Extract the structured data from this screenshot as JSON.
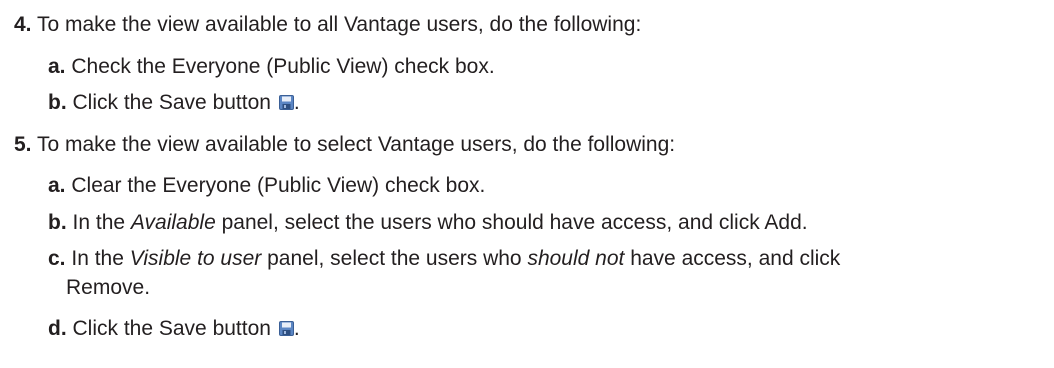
{
  "step4": {
    "number": "4.",
    "text": "To make the view available to all Vantage users, do the following:",
    "a": {
      "letter": "a.",
      "text": "Check the Everyone (Public View) check box."
    },
    "b": {
      "letter": "b.",
      "text": "Click the Save button",
      "icon": "save-icon",
      "end": "."
    }
  },
  "step5": {
    "number": "5.",
    "text": "To make the view available to select Vantage users, do the following:",
    "a": {
      "letter": "a.",
      "text": "Clear the Everyone (Public View) check box."
    },
    "b": {
      "letter": "b.",
      "pre": "In the ",
      "em": "Available",
      "post": " panel, select the users who should have access, and click Add."
    },
    "c": {
      "letter": "c.",
      "pre": "In the ",
      "em": "Visible to user",
      "mid": " panel, select the users who ",
      "em2": "should not",
      "post": " have access, and click",
      "cont": "Remove."
    },
    "d": {
      "letter": "d.",
      "text": "Click the Save button",
      "icon": "save-icon",
      "end": "."
    }
  }
}
